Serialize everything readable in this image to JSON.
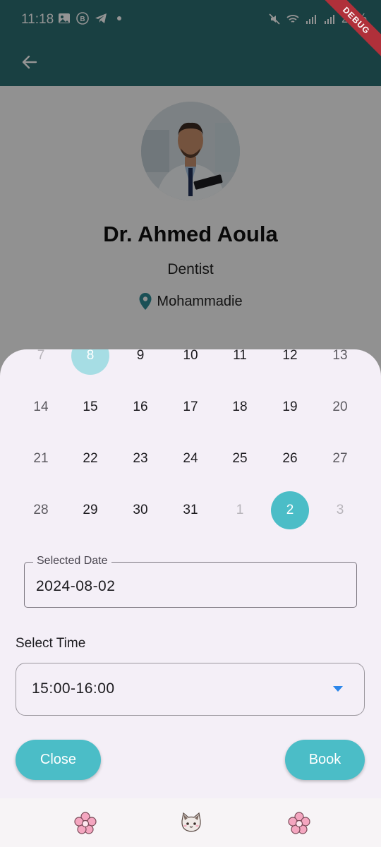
{
  "status_bar": {
    "time": "11:18",
    "battery": "27%"
  },
  "debug_banner": "DEBUG",
  "profile": {
    "name": "Dr. Ahmed  Aoula",
    "specialty": "Dentist",
    "location": "Mohammadie"
  },
  "calendar": {
    "rows": [
      [
        {
          "d": "7",
          "s": "muted"
        },
        {
          "d": "8",
          "s": "today"
        },
        {
          "d": "9",
          "s": ""
        },
        {
          "d": "10",
          "s": ""
        },
        {
          "d": "11",
          "s": ""
        },
        {
          "d": "12",
          "s": ""
        },
        {
          "d": "13",
          "s": "weekend"
        }
      ],
      [
        {
          "d": "14",
          "s": "weekend"
        },
        {
          "d": "15",
          "s": ""
        },
        {
          "d": "16",
          "s": ""
        },
        {
          "d": "17",
          "s": ""
        },
        {
          "d": "18",
          "s": ""
        },
        {
          "d": "19",
          "s": ""
        },
        {
          "d": "20",
          "s": "weekend"
        }
      ],
      [
        {
          "d": "21",
          "s": "weekend"
        },
        {
          "d": "22",
          "s": ""
        },
        {
          "d": "23",
          "s": ""
        },
        {
          "d": "24",
          "s": ""
        },
        {
          "d": "25",
          "s": ""
        },
        {
          "d": "26",
          "s": ""
        },
        {
          "d": "27",
          "s": "weekend"
        }
      ],
      [
        {
          "d": "28",
          "s": "weekend"
        },
        {
          "d": "29",
          "s": ""
        },
        {
          "d": "30",
          "s": ""
        },
        {
          "d": "31",
          "s": ""
        },
        {
          "d": "1",
          "s": "muted"
        },
        {
          "d": "2",
          "s": "selected"
        },
        {
          "d": "3",
          "s": "muted"
        }
      ]
    ]
  },
  "date_field": {
    "label": "Selected Date",
    "value": "2024-08-02"
  },
  "time_section": {
    "label": "Select Time",
    "value": "15:00-16:00"
  },
  "actions": {
    "close_label": "Close",
    "book_label": "Book"
  },
  "colors": {
    "accent": "#4bbdc7",
    "app_bar": "#2c6f72",
    "sheet_bg": "#f4eff7",
    "dropdown_caret": "#2b86ea"
  },
  "bottom_nav": {
    "icons": [
      "flower-icon",
      "cat-icon",
      "flower-icon"
    ]
  }
}
